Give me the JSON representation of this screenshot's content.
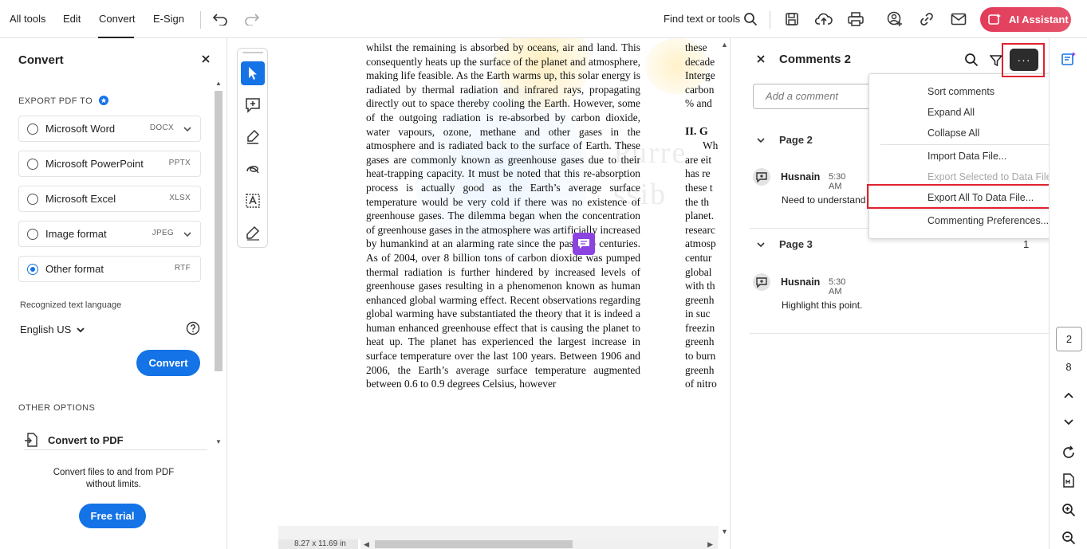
{
  "topbar": {
    "menu": [
      "All tools",
      "Edit",
      "Convert",
      "E-Sign"
    ],
    "find_text": "Find text or tools",
    "ai_label": "AI Assistant"
  },
  "left_panel": {
    "title": "Convert",
    "export_label": "EXPORT PDF TO",
    "formats": [
      {
        "label": "Microsoft Word",
        "ext": "DOCX",
        "dropdown": true,
        "selected": false
      },
      {
        "label": "Microsoft PowerPoint",
        "ext": "PPTX",
        "dropdown": false,
        "selected": false
      },
      {
        "label": "Microsoft Excel",
        "ext": "XLSX",
        "dropdown": false,
        "selected": false
      },
      {
        "label": "Image format",
        "ext": "JPEG",
        "dropdown": true,
        "selected": false
      },
      {
        "label": "Other format",
        "ext": "RTF",
        "dropdown": false,
        "selected": true
      }
    ],
    "language_label": "Recognized text language",
    "language_value": "English US",
    "convert_label": "Convert",
    "other_options_label": "OTHER OPTIONS",
    "convert_to_pdf": "Convert to PDF",
    "promo_line1": "Convert files to and from PDF",
    "promo_line2": "without limits.",
    "free_trial": "Free trial"
  },
  "document": {
    "page_size": "8.27 x 11.69 in",
    "body": "whilst the remaining is absorbed by oceans, air and land. This consequently heats up the surface of the planet and atmosphere, making life feasible. As the Earth warms up, this solar energy is radiated by thermal radiation and infrared rays, propagating directly out to space thereby cooling the Earth. However, some of the outgoing radiation is re-absorbed by carbon dioxide, water vapours, ozone, methane and other gases in the atmosphere and is radiated back to the surface of Earth. These gases are commonly known as greenhouse gases due to their heat-trapping capacity. It must be noted that this re-absorption process is actually good as the Earth’s average surface temperature would be very cold if there was no existence of greenhouse gases. The dilemma began when the concentration of greenhouse gases in the atmosphere was artificially increased by humankind at an alarming rate since the past two centuries. As of 2004, over 8 billion tons of carbon dioxide was pumped thermal radiation is further hindered by increased levels of greenhouse gases resulting in a phenomenon known as human enhanced global warming effect. Recent observations regarding global warming have substantiated the theory that it is indeed a human enhanced greenhouse effect that is causing the planet to heat up. The planet has experienced the largest increase in surface temperature over the last 100 years. Between 1906 and 2006, the Earth’s average surface temperature augmented between 0.6 to 0.9 degrees Celsius, however",
    "col2_top": [
      "these",
      "decade",
      "Interge",
      "carbon",
      "% and"
    ],
    "col2_heading": "II. G",
    "col2_bottom": [
      "Wh",
      "are eit",
      "has re",
      "these t",
      "the th",
      "planet.",
      "researc",
      "atmosp",
      "centur",
      "global",
      "with th",
      "greenh",
      "in suc",
      "freezin",
      "greenh",
      "to burn",
      "greenh",
      "of nitro"
    ],
    "watermark": [
      "Purre",
      "ssib"
    ]
  },
  "comments": {
    "title": "Comments 2",
    "more_label": "···",
    "add_placeholder": "Add a comment",
    "groups": [
      {
        "page": "Page 2",
        "count": "",
        "author": "Husnain",
        "time": "5:30 AM",
        "text": "Need to understand"
      },
      {
        "page": "Page 3",
        "count": "1",
        "author": "Husnain",
        "time": "5:30 AM",
        "text": "Highlight this point."
      }
    ]
  },
  "dropdown": {
    "items": [
      {
        "label": "Sort comments",
        "disabled": false
      },
      {
        "label": "Expand All",
        "disabled": false
      },
      {
        "label": "Collapse All",
        "disabled": false
      },
      {
        "label": "Import Data File...",
        "disabled": false
      },
      {
        "label": "Export Selected to Data File...",
        "disabled": true
      },
      {
        "label": "Export All To Data File...",
        "disabled": false
      },
      {
        "label": "Commenting Preferences...",
        "disabled": false
      }
    ]
  },
  "right_rail": {
    "current_page": "2",
    "total_pages": "8"
  },
  "colors": {
    "accent": "#1473e6",
    "ai_gradient": "#e23b5a",
    "highlight_red": "#e0212e",
    "comment_pin": "#8b44e0"
  }
}
